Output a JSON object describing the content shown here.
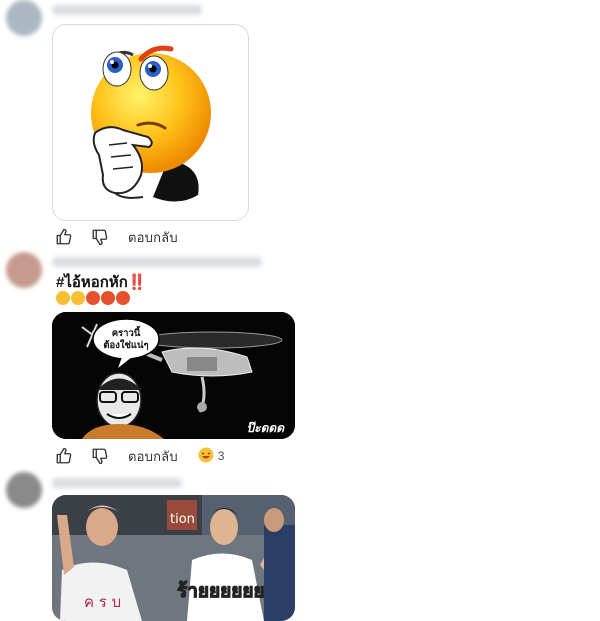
{
  "comments": [
    {
      "id": "c1",
      "attachment": "thinking-emoji-sticker",
      "actions": {
        "reply_label": "ตอบกลับ"
      }
    },
    {
      "id": "c2",
      "text": "#ไอ้หอกหัก‼️",
      "emojis": [
        "🤣",
        "🤣",
        "😡",
        "😡",
        "😡"
      ],
      "image": {
        "bubble_line1": "คราวนี้",
        "bubble_line2": "ต้องใช่แน่ๆ",
        "watermark": "ป๊ะดดด"
      },
      "actions": {
        "reply_label": "ตอบกลับ",
        "reaction_emoji": "🤣",
        "reaction_count": "3"
      }
    },
    {
      "id": "c3",
      "image": {
        "shirt_text": "ค ร บ",
        "caption": "ร้ายยยยยย",
        "sign_text": "tion"
      }
    }
  ],
  "colors": {
    "accent_yellow": "#f7c034",
    "angry_red": "#e5512a",
    "caption_yellow": "#f4e02a"
  }
}
